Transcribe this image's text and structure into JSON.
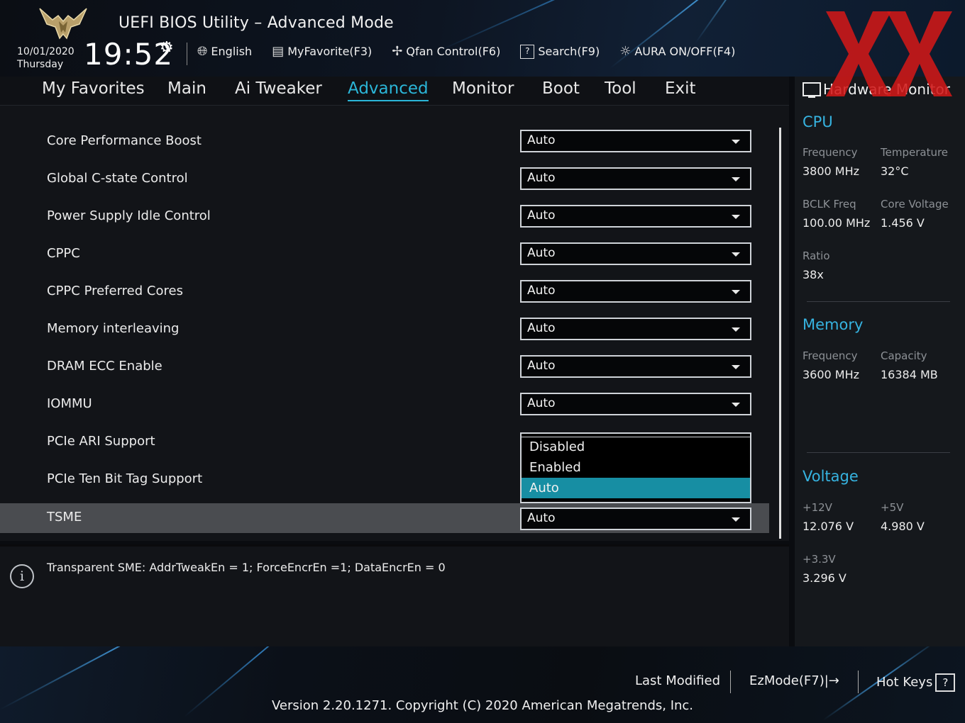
{
  "header": {
    "title": "UEFI BIOS Utility – Advanced Mode",
    "date": "10/01/2020",
    "day": "Thursday",
    "time": "19:52",
    "toolbar": [
      {
        "label": "English",
        "icon": "globe-icon"
      },
      {
        "label": "MyFavorite(F3)",
        "icon": "favorite-icon"
      },
      {
        "label": "Qfan Control(F6)",
        "icon": "fan-icon"
      },
      {
        "label": "Search(F9)",
        "icon": "search-icon"
      },
      {
        "label": "AURA ON/OFF(F4)",
        "icon": "aura-icon"
      }
    ]
  },
  "nav": {
    "tabs": [
      "My Favorites",
      "Main",
      "Ai Tweaker",
      "Advanced",
      "Monitor",
      "Boot",
      "Tool",
      "Exit"
    ],
    "active": "Advanced"
  },
  "settings": [
    {
      "label": "Core Performance Boost",
      "value": "Auto"
    },
    {
      "label": "Global C-state Control",
      "value": "Auto"
    },
    {
      "label": "Power Supply Idle Control",
      "value": "Auto"
    },
    {
      "label": "CPPC",
      "value": "Auto"
    },
    {
      "label": "CPPC Preferred Cores",
      "value": "Auto"
    },
    {
      "label": "Memory interleaving",
      "value": "Auto"
    },
    {
      "label": "DRAM ECC Enable",
      "value": "Auto"
    },
    {
      "label": "IOMMU",
      "value": "Auto"
    },
    {
      "label": "PCIe ARI Support",
      "value": ""
    },
    {
      "label": "PCIe Ten Bit Tag Support",
      "value": ""
    },
    {
      "label": "TSME",
      "value": "Auto"
    }
  ],
  "popup": {
    "options": [
      "Disabled",
      "Enabled",
      "Auto"
    ],
    "selected": "Auto"
  },
  "help": {
    "text": "Transparent SME: AddrTweakEn = 1; ForceEncrEn =1; DataEncrEn = 0"
  },
  "hardware_monitor": {
    "title": "Hardware Monitor",
    "cpu": {
      "heading": "CPU",
      "frequency_label": "Frequency",
      "frequency": "3800 MHz",
      "temperature_label": "Temperature",
      "temperature": "32°C",
      "bclk_label": "BCLK Freq",
      "bclk": "100.00 MHz",
      "core_voltage_label": "Core Voltage",
      "core_voltage": "1.456 V",
      "ratio_label": "Ratio",
      "ratio": "38x"
    },
    "memory": {
      "heading": "Memory",
      "frequency_label": "Frequency",
      "frequency": "3600 MHz",
      "capacity_label": "Capacity",
      "capacity": "16384 MB"
    },
    "voltage": {
      "heading": "Voltage",
      "v12_label": "+12V",
      "v12": "12.076 V",
      "v5_label": "+5V",
      "v5": "4.980 V",
      "v33_label": "+3.3V",
      "v33": "3.296 V"
    }
  },
  "footer": {
    "last_modified": "Last Modified",
    "ezmode": "EzMode(F7)|",
    "hot_keys": "Hot Keys",
    "hot_keys_icon": "?",
    "version": "Version 2.20.1271. Copyright (C) 2020 American Megatrends, Inc."
  },
  "colors": {
    "accent": "#2bb6d8",
    "selected_option": "#178ea3",
    "watermark": "#d01818"
  }
}
